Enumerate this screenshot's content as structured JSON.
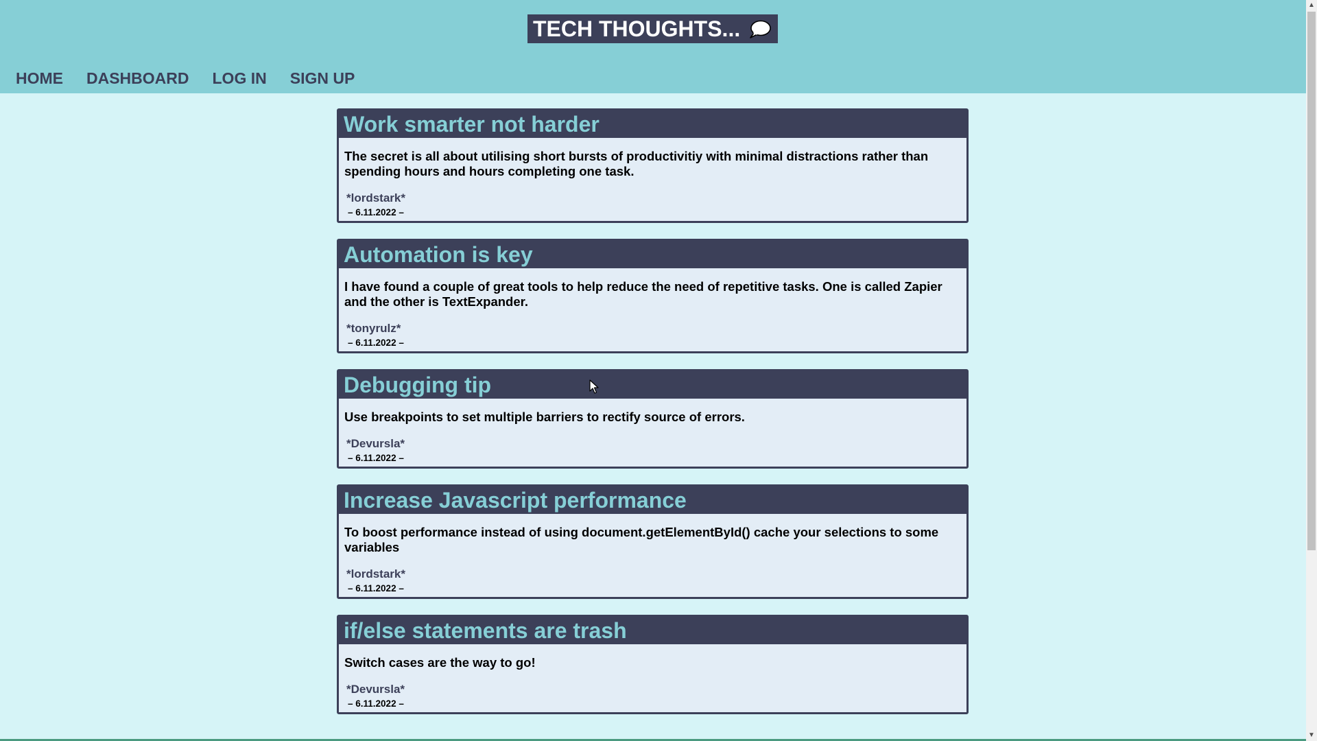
{
  "header": {
    "brand_text": "TECH THOUGHTS...",
    "brand_icon": "speech-bubble-icon"
  },
  "nav": {
    "items": [
      {
        "label": "HOME"
      },
      {
        "label": "DASHBOARD"
      },
      {
        "label": "LOG IN"
      },
      {
        "label": "SIGN UP"
      }
    ]
  },
  "posts": [
    {
      "title": "Work smarter not harder",
      "body": "The secret is all about utilising short bursts of productivitiy with minimal distractions rather than spending hours and hours completing one task.",
      "author": "*lordstark*",
      "date": "– 6.11.2022 –"
    },
    {
      "title": "Automation is key",
      "body": "I have found a couple of great tools to help reduce the need of repetitive tasks. One is called Zapier and the other is TextExpander.",
      "author": "*tonyrulz*",
      "date": "– 6.11.2022 –"
    },
    {
      "title": "Debugging tip",
      "body": "Use breakpoints to set multiple barriers to rectify source of errors.",
      "author": "*Devursla*",
      "date": "– 6.11.2022 –"
    },
    {
      "title": "Increase Javascript performance",
      "body": "To boost performance instead of using document.getElementById() cache your selections to some variables",
      "author": "*lordstark*",
      "date": "– 6.11.2022 –"
    },
    {
      "title": "if/else statements are trash",
      "body": "Switch cases are the way to go!",
      "author": "*Devursla*",
      "date": "– 6.11.2022 –"
    }
  ],
  "colors": {
    "page_background": "#d6f4f7",
    "header_background": "#86cfd6",
    "dark_navy": "#3c4059",
    "card_background": "#e3edf6",
    "title_text": "#86cfd6"
  }
}
